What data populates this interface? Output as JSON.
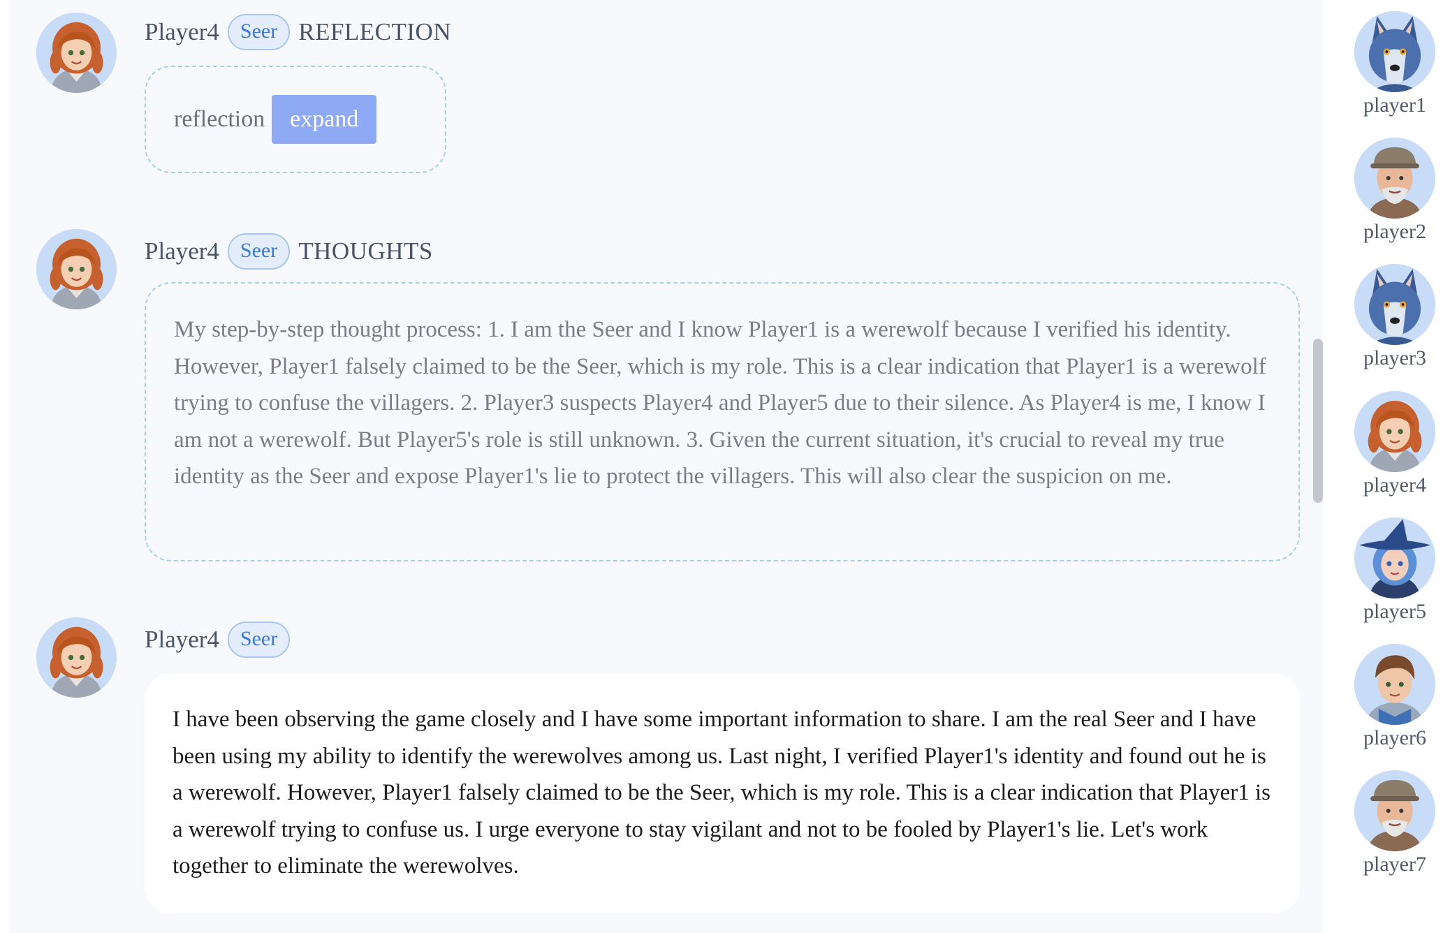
{
  "chat": {
    "messages": [
      {
        "player": "Player4",
        "role": "Seer",
        "type": "REFLECTION",
        "reflection_label": "reflection",
        "expand_label": "expand"
      },
      {
        "player": "Player4",
        "role": "Seer",
        "type": "THOUGHTS",
        "text": "My step-by-step thought process: 1. I am the Seer and I know Player1 is a werewolf because I verified his identity. However, Player1 falsely claimed to be the Seer, which is my role. This is a clear indication that Player1 is a werewolf trying to confuse the villagers. 2. Player3 suspects Player4 and Player5 due to their silence. As Player4 is me, I know I am not a werewolf. But Player5's role is still unknown. 3. Given the current situation, it's crucial to reveal my true identity as the Seer and expose Player1's lie to protect the villagers. This will also clear the suspicion on me."
      },
      {
        "player": "Player4",
        "role": "Seer",
        "text": "I have been observing the game closely and I have some important information to share. I am the real Seer and I have been using my ability to identify the werewolves among us. Last night, I verified Player1's identity and found out he is a werewolf. However, Player1 falsely claimed to be the Seer, which is my role. This is a clear indication that Player1 is a werewolf trying to confuse us. I urge everyone to stay vigilant and not to be fooled by Player1's lie. Let's work together to eliminate the werewolves."
      }
    ]
  },
  "players": [
    {
      "name": "player1",
      "avatar": "wolf-avatar-icon"
    },
    {
      "name": "player2",
      "avatar": "old-man-avatar-icon"
    },
    {
      "name": "player3",
      "avatar": "wolf-avatar-icon"
    },
    {
      "name": "player4",
      "avatar": "red-haired-girl-avatar-icon"
    },
    {
      "name": "player5",
      "avatar": "witch-avatar-icon"
    },
    {
      "name": "player6",
      "avatar": "knight-avatar-icon"
    },
    {
      "name": "player7",
      "avatar": "old-man-avatar-icon"
    }
  ],
  "colors": {
    "accent_badge_text": "#3c78d8",
    "expand_button": "#8eaaf5",
    "dashed_border": "#a7d2e6",
    "panel_background": "#f7f9fc"
  }
}
